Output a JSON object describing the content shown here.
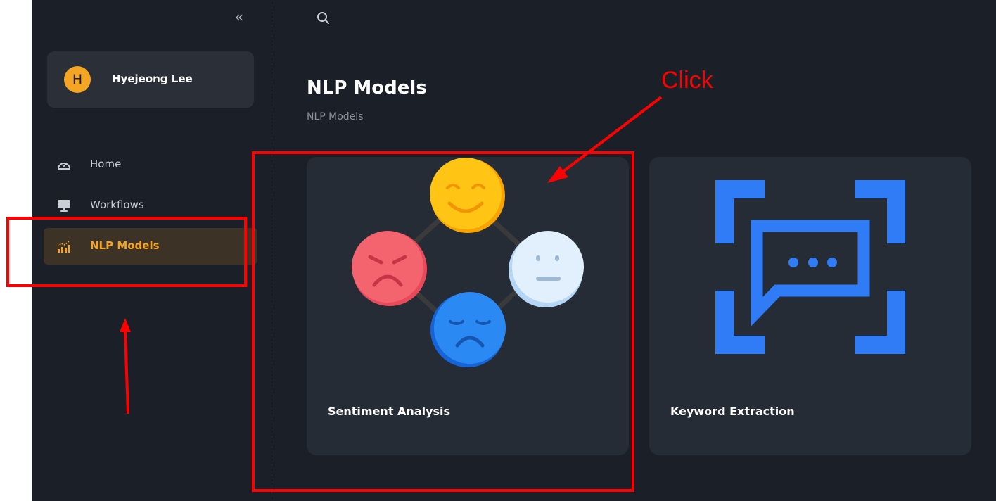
{
  "sidebar": {
    "collapse_label": "«",
    "user": {
      "initial": "H",
      "name": "Hyejeong Lee"
    },
    "items": [
      {
        "label": "Home",
        "icon": "gauge-icon",
        "active": false
      },
      {
        "label": "Workflows",
        "icon": "monitor-icon",
        "active": false
      },
      {
        "label": "NLP Models",
        "icon": "chart-growth-icon",
        "active": true
      }
    ]
  },
  "header": {
    "search_icon": "search-icon"
  },
  "main": {
    "title": "NLP Models",
    "breadcrumb": "NLP Models",
    "cards": [
      {
        "label": "Sentiment Analysis",
        "icon": "emotion-faces-icon"
      },
      {
        "label": "Keyword Extraction",
        "icon": "chat-scan-icon"
      }
    ]
  },
  "annotation": {
    "click_text": "Click"
  },
  "colors": {
    "background": "#1b2028",
    "card": "#262c35",
    "accent": "#f5a524",
    "active_bg": "#3c3226",
    "keyword_blue": "#2f7cf6",
    "annotation_red": "#ff0000"
  }
}
